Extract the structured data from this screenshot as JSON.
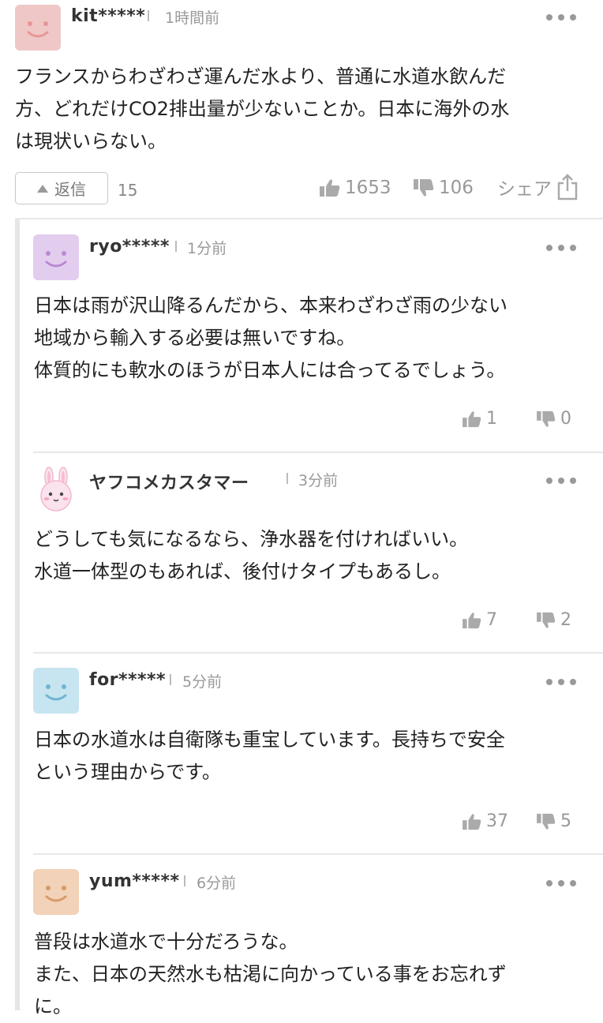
{
  "main_comment": {
    "username": "kit*****",
    "time": "1時間前",
    "text": "フランスからわざわざ運んだ水より、普通に水道水飲んだ\n方、どれだけCO2排出量が少ないことか。日本に海外の水\nは現状いらない。",
    "avatar_color": "#f0c7c7",
    "reply_label": "返信",
    "reply_count": "15",
    "likes": "1653",
    "dislikes": "106",
    "share_label": "シェア"
  },
  "replies": [
    {
      "username": "ryo*****",
      "time": "1分前",
      "text": "日本は雨が沢山降るんだから、本来わざわざ雨の少ない\n地域から輸入する必要は無いですね。\n体質的にも軟水のほうが日本人には合ってるでしょう。",
      "avatar_color": "#e3cdef",
      "avatar_icon": "smiley-icon",
      "likes": "1",
      "dislikes": "0"
    },
    {
      "username": "ヤフコメカスタマー",
      "time": "3分前",
      "text": "どうしても気になるなら、浄水器を付ければいい。\n水道一体型のもあれば、後付けタイプもあるし。",
      "avatar_color": "#f7d8e6",
      "avatar_icon": "rabbit-icon",
      "likes": "7",
      "dislikes": "2"
    },
    {
      "username": "for*****",
      "time": "5分前",
      "text": "日本の水道水は自衛隊も重宝しています。長持ちで安全\nという理由からです。",
      "avatar_color": "#c7e5f1",
      "avatar_icon": "smiley-icon",
      "likes": "37",
      "dislikes": "5"
    },
    {
      "username": "yum*****",
      "time": "6分前",
      "text": "普段は水道水で十分だろうな。\nまた、日本の天然水も枯渇に向かっている事をお忘れず\nに。",
      "avatar_color": "#f2d2b8",
      "avatar_icon": "smiley-icon",
      "likes": "",
      "dislikes": ""
    }
  ]
}
